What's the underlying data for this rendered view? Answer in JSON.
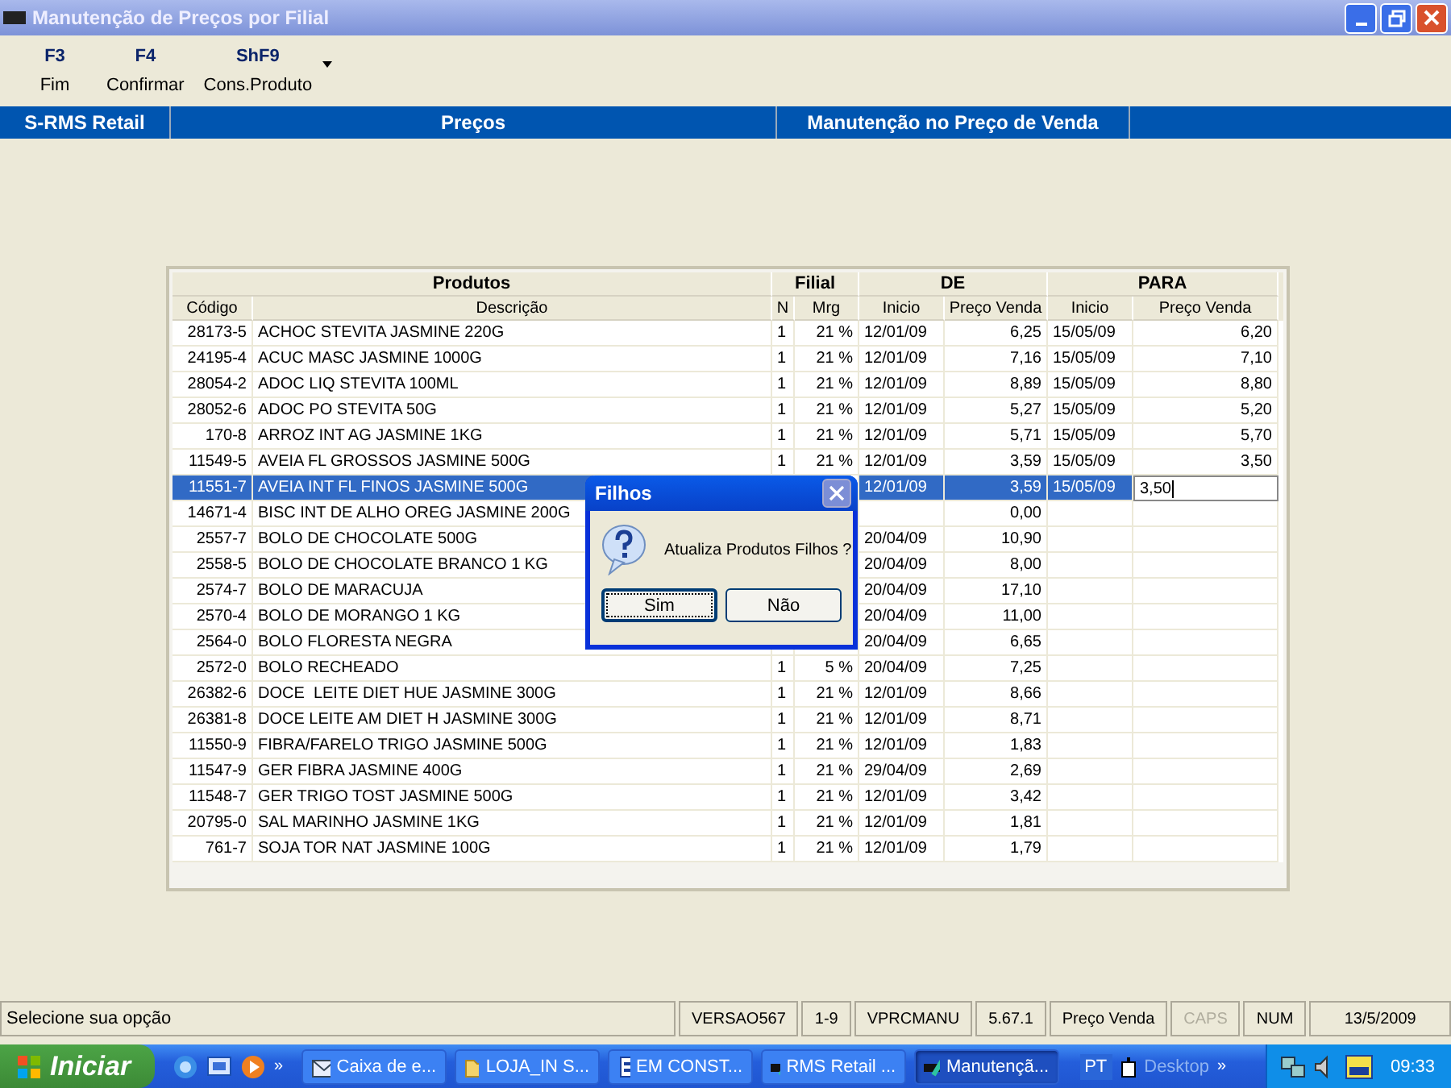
{
  "window": {
    "title": "Manutenção de Preços por Filial"
  },
  "toolbar": [
    {
      "key": "F3",
      "label": "Fim"
    },
    {
      "key": "F4",
      "label": "Confirmar"
    },
    {
      "key": "ShF9",
      "label": "Cons.Produto"
    }
  ],
  "section_bar": [
    "S-RMS Retail",
    "Preços",
    "Manutenção no Preço de Venda"
  ],
  "table": {
    "group_headers": [
      "Produtos",
      "Filial",
      "DE",
      "PARA"
    ],
    "columns": [
      "Código",
      "Descrição",
      "N",
      "Mrg",
      "Inicio",
      "Preço Venda",
      "Inicio",
      "Preço Venda"
    ],
    "rows": [
      {
        "code": "28173-5",
        "desc": "ACHOC STEVITA JASMINE 220G",
        "n": "1",
        "mrg": "21 %",
        "de_inicio": "12/01/09",
        "de_preco": "6,25",
        "para_inicio": "15/05/09",
        "para_preco": "6,20",
        "selected": false
      },
      {
        "code": "24195-4",
        "desc": "ACUC MASC JASMINE 1000G",
        "n": "1",
        "mrg": "21 %",
        "de_inicio": "12/01/09",
        "de_preco": "7,16",
        "para_inicio": "15/05/09",
        "para_preco": "7,10",
        "selected": false
      },
      {
        "code": "28054-2",
        "desc": "ADOC LIQ STEVITA 100ML",
        "n": "1",
        "mrg": "21 %",
        "de_inicio": "12/01/09",
        "de_preco": "8,89",
        "para_inicio": "15/05/09",
        "para_preco": "8,80",
        "selected": false
      },
      {
        "code": "28052-6",
        "desc": "ADOC PO STEVITA 50G",
        "n": "1",
        "mrg": "21 %",
        "de_inicio": "12/01/09",
        "de_preco": "5,27",
        "para_inicio": "15/05/09",
        "para_preco": "5,20",
        "selected": false
      },
      {
        "code": "170-8",
        "desc": "ARROZ INT AG JASMINE 1KG",
        "n": "1",
        "mrg": "21 %",
        "de_inicio": "12/01/09",
        "de_preco": "5,71",
        "para_inicio": "15/05/09",
        "para_preco": "5,70",
        "selected": false
      },
      {
        "code": "11549-5",
        "desc": "AVEIA FL GROSSOS JASMINE 500G",
        "n": "1",
        "mrg": "21 %",
        "de_inicio": "12/01/09",
        "de_preco": "3,59",
        "para_inicio": "15/05/09",
        "para_preco": "3,50",
        "selected": false
      },
      {
        "code": "11551-7",
        "desc": "AVEIA INT FL FINOS JASMINE 500G",
        "de_inicio": "12/01/09",
        "de_preco": "3,59",
        "para_inicio": "15/05/09",
        "para_preco": "3,50",
        "selected": true
      },
      {
        "code": "14671-4",
        "desc": "BISC INT DE ALHO OREG JASMINE 200G",
        "de_preco": "0,00",
        "selected": false
      },
      {
        "code": "2557-7",
        "desc": "BOLO DE CHOCOLATE 500G",
        "de_inicio": "20/04/09",
        "de_preco": "10,90",
        "selected": false
      },
      {
        "code": "2558-5",
        "desc": "BOLO DE CHOCOLATE BRANCO 1 KG",
        "de_inicio": "20/04/09",
        "de_preco": "8,00",
        "selected": false
      },
      {
        "code": "2574-7",
        "desc": "BOLO DE MARACUJA",
        "de_inicio": "20/04/09",
        "de_preco": "17,10",
        "selected": false
      },
      {
        "code": "2570-4",
        "desc": "BOLO DE MORANGO 1 KG",
        "de_inicio": "20/04/09",
        "de_preco": "11,00",
        "selected": false
      },
      {
        "code": "2564-0",
        "desc": "BOLO FLORESTA NEGRA",
        "de_inicio": "20/04/09",
        "de_preco": "6,65",
        "selected": false
      },
      {
        "code": "2572-0",
        "desc": "BOLO RECHEADO",
        "n": "1",
        "mrg": "5 %",
        "de_inicio": "20/04/09",
        "de_preco": "7,25",
        "selected": false
      },
      {
        "code": "26382-6",
        "desc": "DOCE  LEITE DIET HUE JASMINE 300G",
        "n": "1",
        "mrg": "21 %",
        "de_inicio": "12/01/09",
        "de_preco": "8,66",
        "selected": false
      },
      {
        "code": "26381-8",
        "desc": "DOCE LEITE AM DIET H JASMINE 300G",
        "n": "1",
        "mrg": "21 %",
        "de_inicio": "12/01/09",
        "de_preco": "8,71",
        "selected": false
      },
      {
        "code": "11550-9",
        "desc": "FIBRA/FARELO TRIGO JASMINE 500G",
        "n": "1",
        "mrg": "21 %",
        "de_inicio": "12/01/09",
        "de_preco": "1,83",
        "selected": false
      },
      {
        "code": "11547-9",
        "desc": "GER FIBRA JASMINE 400G",
        "n": "1",
        "mrg": "21 %",
        "de_inicio": "29/04/09",
        "de_preco": "2,69",
        "selected": false
      },
      {
        "code": "11548-7",
        "desc": "GER TRIGO TOST JASMINE 500G",
        "n": "1",
        "mrg": "21 %",
        "de_inicio": "12/01/09",
        "de_preco": "3,42",
        "selected": false
      },
      {
        "code": "20795-0",
        "desc": "SAL MARINHO JASMINE 1KG",
        "n": "1",
        "mrg": "21 %",
        "de_inicio": "12/01/09",
        "de_preco": "1,81",
        "selected": false
      },
      {
        "code": "761-7",
        "desc": "SOJA TOR NAT JASMINE 100G",
        "n": "1",
        "mrg": "21 %",
        "de_inicio": "12/01/09",
        "de_preco": "1,79",
        "selected": false
      }
    ]
  },
  "dialog": {
    "title": "Filhos",
    "message": "Atualiza Produtos Filhos ?",
    "buttons": [
      {
        "label": "Sim",
        "focused": true
      },
      {
        "label": "Não",
        "focused": false
      }
    ]
  },
  "status_bar": {
    "message": "Selecione sua opção",
    "cells": [
      {
        "text": "VERSAO567",
        "disabled": false
      },
      {
        "text": "1-9",
        "disabled": false
      },
      {
        "text": "VPRCMANU",
        "disabled": false
      },
      {
        "text": "5.67.1",
        "disabled": false
      },
      {
        "text": "Preço Venda",
        "disabled": false
      },
      {
        "text": "CAPS",
        "disabled": true
      },
      {
        "text": "NUM",
        "disabled": false
      },
      {
        "text": "13/5/2009",
        "disabled": false
      }
    ]
  },
  "taskbar": {
    "start": "Iniciar",
    "quick_more": "»",
    "tasks": [
      {
        "label": "Caixa de e...",
        "kind": "mail",
        "selected": false
      },
      {
        "label": "LOJA_IN S...",
        "kind": "folder",
        "selected": false
      },
      {
        "label": "EM CONST...",
        "kind": "doc",
        "selected": false
      },
      {
        "label": "RMS Retail ...",
        "kind": "app",
        "selected": false
      },
      {
        "label": "Manutençã...",
        "kind": "app",
        "selected": true
      }
    ],
    "language": "PT",
    "desktop": "Desktop",
    "desktop_more": "»",
    "clock": "09:33"
  }
}
